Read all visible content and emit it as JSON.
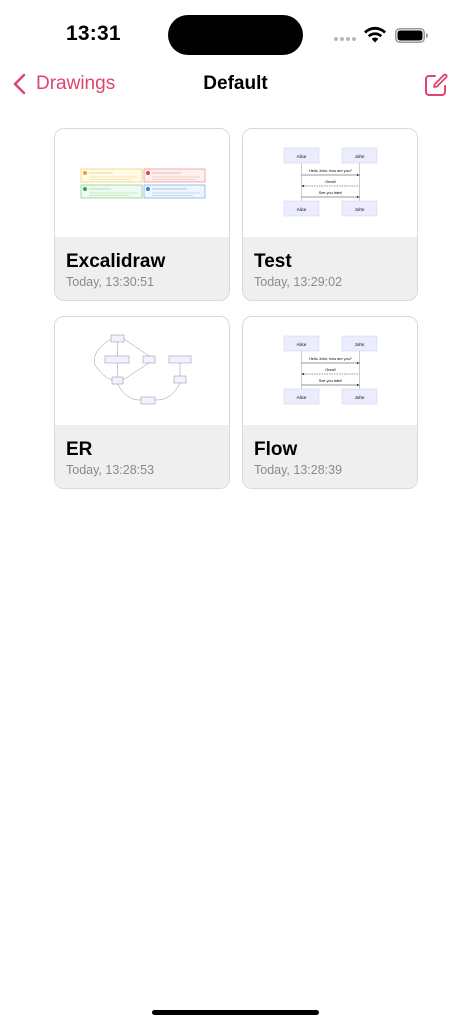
{
  "status_bar": {
    "time": "13:31"
  },
  "nav": {
    "back_label": "Drawings",
    "title": "Default",
    "compose_icon": "compose-icon"
  },
  "colors": {
    "accent": "#e0446e",
    "meta_bg": "#efefef",
    "date_text": "#8a8a8a"
  },
  "drawings": [
    {
      "title": "Excalidraw",
      "date": "Today, 13:30:51"
    },
    {
      "title": "Test",
      "date": "Today, 13:29:02"
    },
    {
      "title": "ER",
      "date": "Today, 13:28:53"
    },
    {
      "title": "Flow",
      "date": "Today, 13:28:39"
    }
  ],
  "sequence_preview": {
    "actor_a": "Alice",
    "actor_b": "John",
    "messages": [
      "Hello John, how are you?",
      "Great!",
      "See you later!"
    ]
  }
}
